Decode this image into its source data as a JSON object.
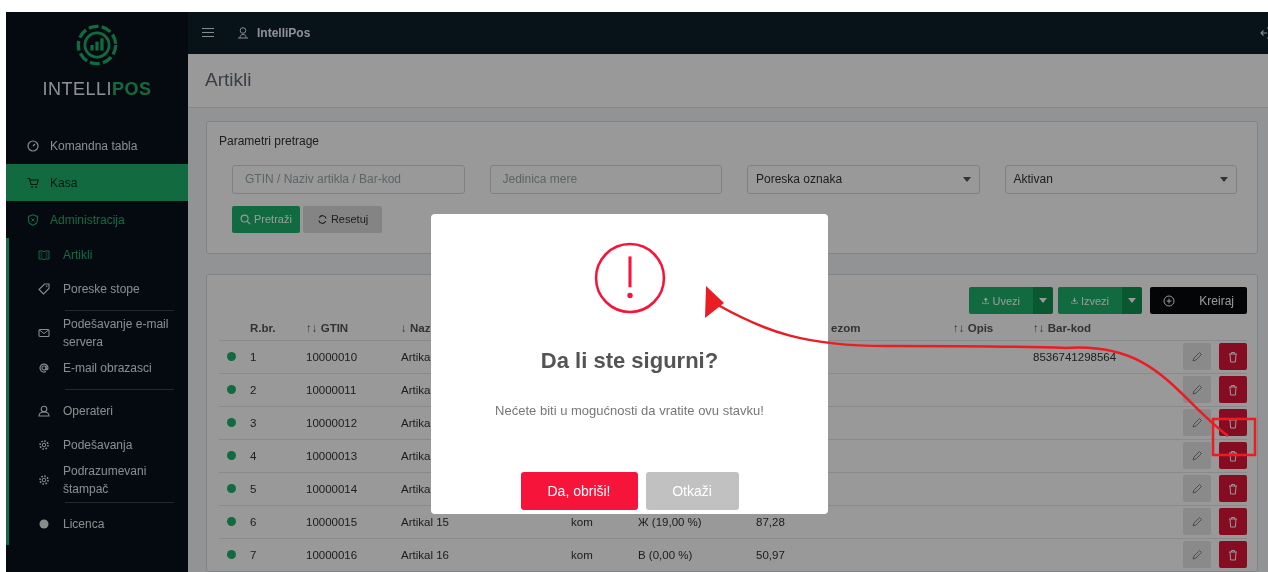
{
  "sidebar": {
    "logo": {
      "light": "INTELLI",
      "bold": "POS"
    },
    "items": [
      {
        "label": "Komandna tabla",
        "selected": false
      },
      {
        "label": "Kasa",
        "selected": true
      },
      {
        "label": "Administracija",
        "selected": false,
        "expanded": true,
        "children": [
          {
            "label": "Artikli",
            "selected": true,
            "divider_after": false
          },
          {
            "label": "Poreske stope",
            "selected": false,
            "divider_after": true
          },
          {
            "label": "Podešavanje e-mail servera",
            "selected": false,
            "divider_after": false
          },
          {
            "label": "E-mail obrazasci",
            "selected": false,
            "divider_after": true
          },
          {
            "label": "Operateri",
            "selected": false,
            "divider_after": false
          },
          {
            "label": "Podešavanja",
            "selected": false,
            "divider_after": false
          },
          {
            "label": "Podrazumevani štampač",
            "selected": false,
            "divider_after": true
          },
          {
            "label": "Licenca",
            "selected": false,
            "divider_after": false
          }
        ]
      }
    ]
  },
  "topbar": {
    "user": "IntelliPos"
  },
  "page_title": "Artikli",
  "search": {
    "title": "Parametri pretrage",
    "fields": [
      {
        "kind": "text",
        "placeholder": "GTIN / Naziv artikla / Bar-kod"
      },
      {
        "kind": "text",
        "placeholder": "Jedinica mere"
      },
      {
        "kind": "select",
        "value": "Poreska oznaka"
      },
      {
        "kind": "select",
        "value": "Aktivan"
      }
    ],
    "buttons": [
      {
        "kind": "primary",
        "label": "Pretraži"
      },
      {
        "kind": "secondary",
        "label": "Resetuj"
      }
    ]
  },
  "toolbar": [
    {
      "kind": "split",
      "label": "Uvezi"
    },
    {
      "kind": "split",
      "label": "Izvezi"
    },
    {
      "kind": "dark",
      "label": "Kreiraj"
    }
  ],
  "table": {
    "columns": [
      {
        "label": "R.br."
      },
      {
        "label": "GTIN",
        "sort_mark": "↑↓"
      },
      {
        "label": "Naz",
        "sort_mark": "↓"
      },
      {
        "label": "ezom"
      },
      {
        "label": "Opis",
        "sort_mark": "↑↓"
      },
      {
        "label": "Bar-kod",
        "sort_mark": "↑↓"
      }
    ],
    "rows": [
      {
        "active": true,
        "number": "1",
        "gtin": "10000010",
        "name": "Artika",
        "barcode": "8536741298564",
        "delete_highlighted": false
      },
      {
        "active": true,
        "number": "2",
        "gtin": "10000011",
        "name": "Artika",
        "delete_highlighted": false
      },
      {
        "active": true,
        "number": "3",
        "gtin": "10000012",
        "name": "Artika",
        "delete_highlighted": true
      },
      {
        "active": true,
        "number": "4",
        "gtin": "10000013",
        "name": "Artika",
        "delete_highlighted": false
      },
      {
        "active": true,
        "number": "5",
        "gtin": "10000014",
        "name": "Artika",
        "delete_highlighted": false
      },
      {
        "active": true,
        "number": "6",
        "gtin": "10000015",
        "name": "Artikal 15",
        "unit": "kom",
        "tax": "Ж (19,00 %)",
        "price": "87,28",
        "delete_highlighted": false
      },
      {
        "active": true,
        "number": "7",
        "gtin": "10000016",
        "name": "Artikal 16",
        "unit": "kom",
        "tax": "B (0,00 %)",
        "price": "50,97",
        "delete_highlighted": false
      }
    ]
  },
  "dialog": {
    "title": "Da li ste sigurni?",
    "text": "Nećete biti u mogućnosti da vratite ovu stavku!",
    "buttons": [
      {
        "kind": "confirm",
        "label": "Da, obriši!"
      },
      {
        "kind": "cancel",
        "label": "Otkaži"
      }
    ]
  }
}
